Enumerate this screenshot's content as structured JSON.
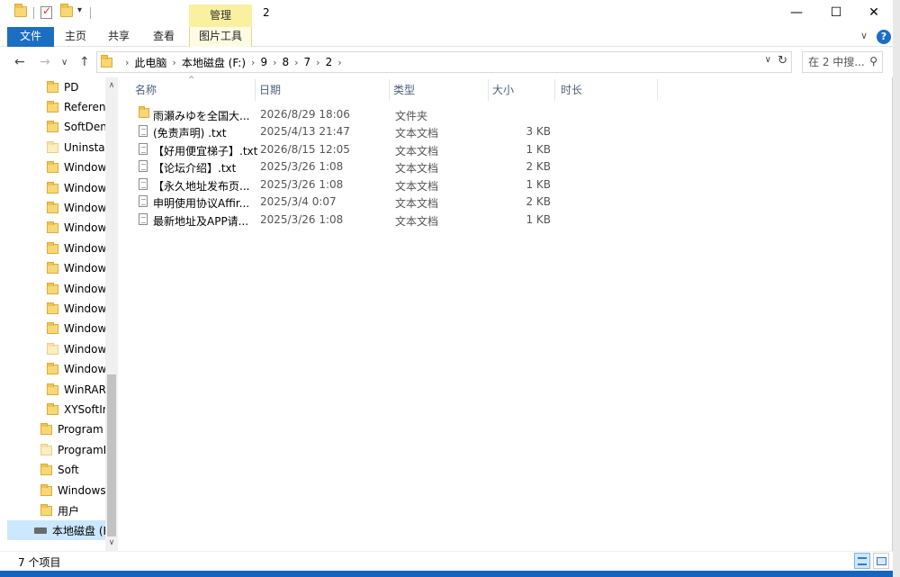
{
  "window": {
    "title": "2",
    "context_tab_group": "管理",
    "min_glyph": "—",
    "max_glyph": "☐",
    "close_glyph": "✕"
  },
  "ribbon": {
    "tabs": [
      {
        "label": "文件",
        "active": true
      },
      {
        "label": "主页"
      },
      {
        "label": "共享"
      },
      {
        "label": "查看"
      },
      {
        "label": "图片工具",
        "contextual": true
      }
    ],
    "collapse_glyph": "∨",
    "help_glyph": "?"
  },
  "navigation": {
    "back": "←",
    "forward": "→",
    "recent": "∨",
    "up": "↑"
  },
  "address": {
    "sep": "›",
    "crumbs": [
      "此电脑",
      "本地磁盘 (F:)",
      "9",
      "8",
      "7",
      "2"
    ],
    "dropdown": "∨",
    "refresh": "↻"
  },
  "search": {
    "placeholder": "在 2 中搜...",
    "icon": "search-icon"
  },
  "sidebar": {
    "items": [
      {
        "label": "PD"
      },
      {
        "label": "Reference"
      },
      {
        "label": "SoftDen"
      },
      {
        "label": "Uninstal"
      },
      {
        "label": "Window"
      },
      {
        "label": "Window"
      },
      {
        "label": "Window"
      },
      {
        "label": "Window"
      },
      {
        "label": "Window"
      },
      {
        "label": "Window"
      },
      {
        "label": "Window"
      },
      {
        "label": "Window"
      },
      {
        "label": "Window"
      },
      {
        "label": "Window"
      },
      {
        "label": "Window"
      },
      {
        "label": "WinRAR"
      },
      {
        "label": "XYSoftIr"
      },
      {
        "label": "Program"
      },
      {
        "label": "ProgramD"
      },
      {
        "label": "Soft"
      },
      {
        "label": "Windows"
      },
      {
        "label": "用户"
      },
      {
        "label": "本地磁盘 (F"
      }
    ],
    "scroll_up": "∧",
    "scroll_down": "∨"
  },
  "columns": {
    "name": "名称",
    "date": "日期",
    "type": "类型",
    "size": "大小",
    "duration": "时长",
    "sort_glyph": "^"
  },
  "files": [
    {
      "name": "雨瀬みゆを全国大...",
      "date": "2026/8/29 18:06",
      "type": "文件夹",
      "size": "",
      "kind": "folder"
    },
    {
      "name": "(免责声明) .txt",
      "date": "2025/4/13 21:47",
      "type": "文本文档",
      "size": "3 KB",
      "kind": "txt"
    },
    {
      "name": "【好用便宜梯子】.txt",
      "date": "2026/8/15 12:05",
      "type": "文本文档",
      "size": "1 KB",
      "kind": "txt"
    },
    {
      "name": "【论坛介绍】.txt",
      "date": "2025/3/26 1:08",
      "type": "文本文档",
      "size": "2 KB",
      "kind": "txt"
    },
    {
      "name": "【永久地址发布页...",
      "date": "2025/3/26 1:08",
      "type": "文本文档",
      "size": "1 KB",
      "kind": "txt"
    },
    {
      "name": "申明使用协议Affir...",
      "date": "2025/3/4 0:07",
      "type": "文本文档",
      "size": "2 KB",
      "kind": "txt"
    },
    {
      "name": "最新地址及APP请...",
      "date": "2025/3/26 1:08",
      "type": "文本文档",
      "size": "1 KB",
      "kind": "txt"
    }
  ],
  "status": {
    "item_count": "7 个项目"
  }
}
